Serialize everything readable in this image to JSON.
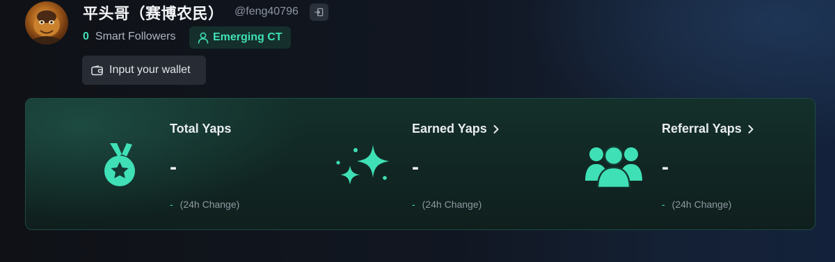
{
  "profile": {
    "name": "平头哥（赛博农民）",
    "handle": "@feng40796",
    "smart_followers_count": "0",
    "smart_followers_label": "Smart Followers",
    "badge_label": "Emerging CT",
    "wallet_button_label": "Input your wallet"
  },
  "stats": [
    {
      "title": "Total Yaps",
      "value": "-",
      "change": "-",
      "change_label": "(24h Change)",
      "icon": "medal-icon",
      "has_link": false
    },
    {
      "title": "Earned Yaps",
      "value": "-",
      "change": "-",
      "change_label": "(24h Change)",
      "icon": "sparkles-icon",
      "has_link": true
    },
    {
      "title": "Referral Yaps",
      "value": "-",
      "change": "-",
      "change_label": "(24h Change)",
      "icon": "users-icon",
      "has_link": true
    }
  ],
  "colors": {
    "accent": "#3fe0b5",
    "card_background": "#122824",
    "page_background": "#10141b"
  }
}
